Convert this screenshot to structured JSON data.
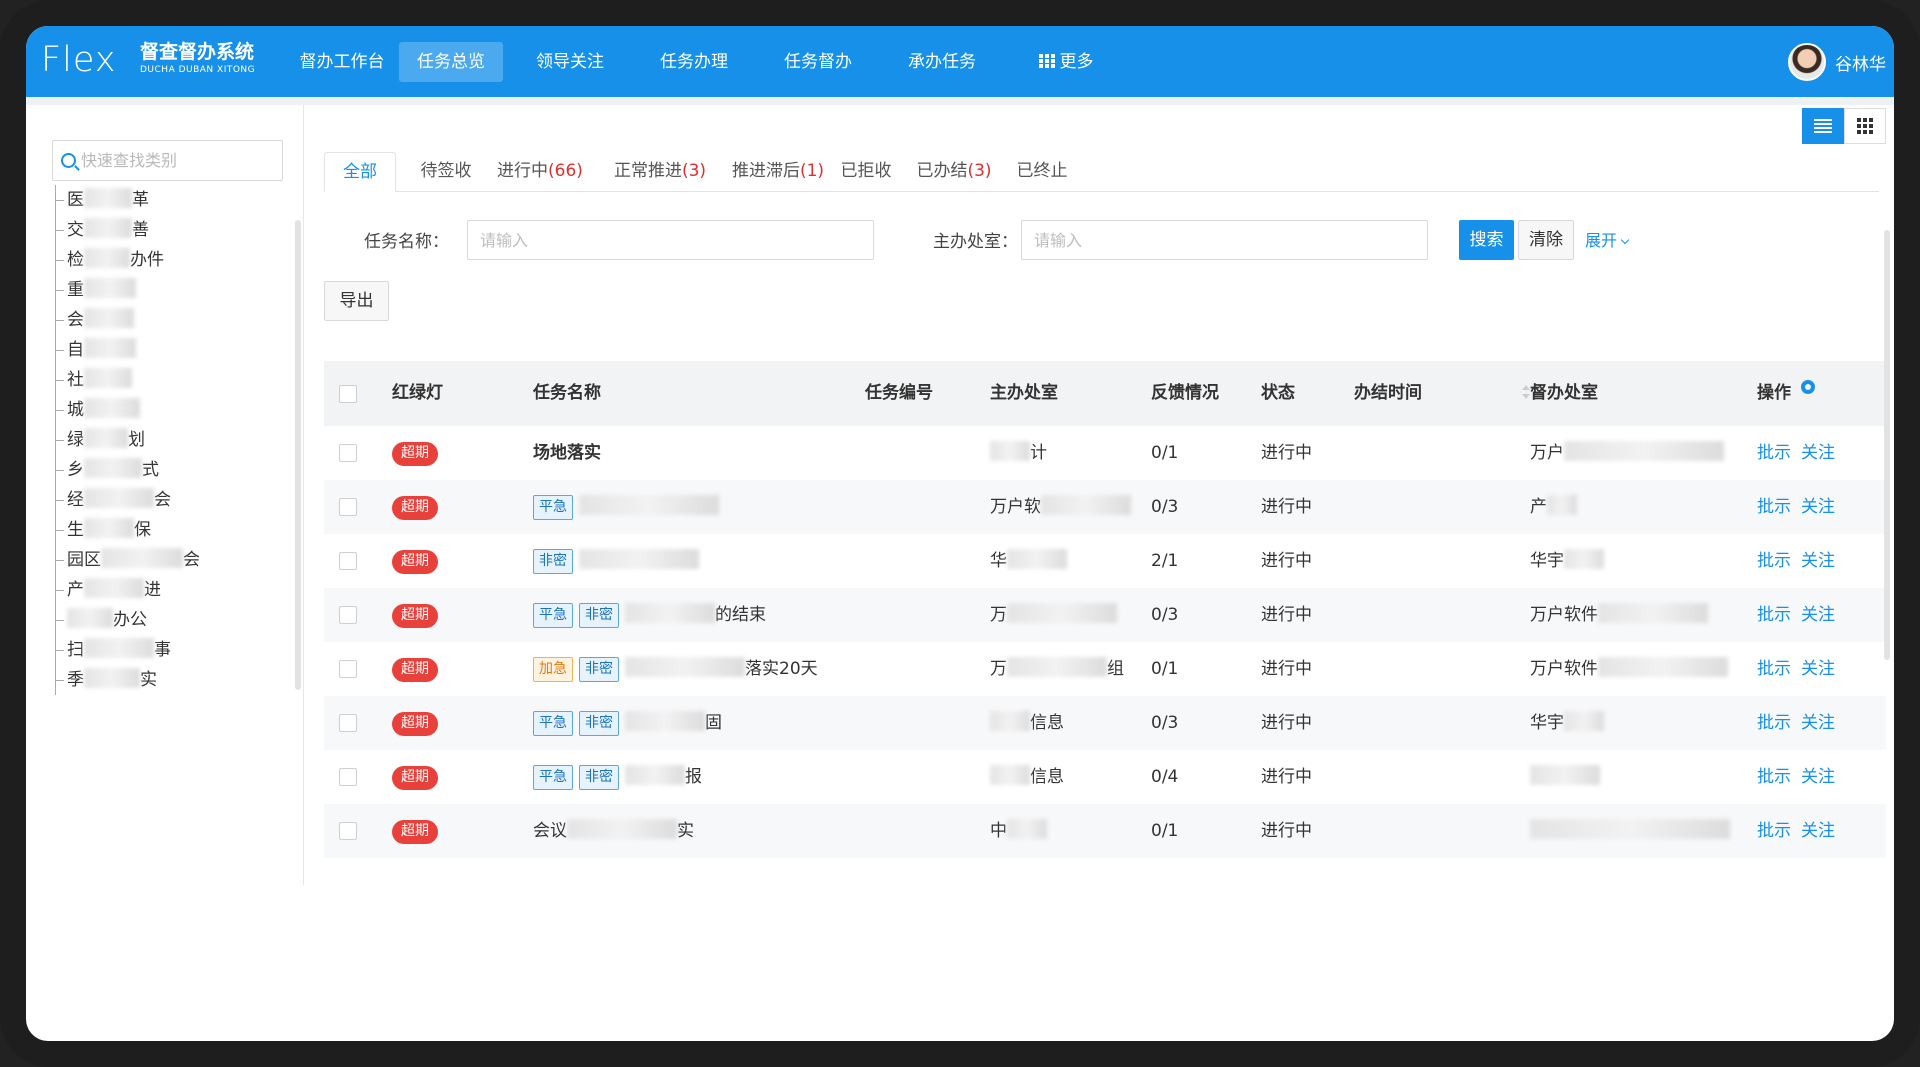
{
  "app": {
    "logo_text": "Flex",
    "name_cn": "督查督办系统",
    "name_en": "DUCHA DUBAN XITONG"
  },
  "nav": {
    "items": [
      "督办工作台",
      "任务总览",
      "领导关注",
      "任务办理",
      "任务督办",
      "承办任务"
    ],
    "more_label": "更多",
    "active_index": 1
  },
  "user": {
    "name": "谷林华"
  },
  "sidebar": {
    "search_placeholder": "快速查找类别",
    "items": [
      {
        "pre": "医",
        "post": "革"
      },
      {
        "pre": "交",
        "post": "善"
      },
      {
        "pre": "检",
        "post": "办件"
      },
      {
        "pre": "重",
        "post": ""
      },
      {
        "pre": "会",
        "post": ""
      },
      {
        "pre": "自",
        "post": ""
      },
      {
        "pre": "社",
        "post": ""
      },
      {
        "pre": "城",
        "post": ""
      },
      {
        "pre": "绿",
        "post": "划"
      },
      {
        "pre": "乡",
        "post": "式"
      },
      {
        "pre": "经",
        "post": "会"
      },
      {
        "pre": "生",
        "post": "保"
      },
      {
        "pre": "园区",
        "post": "会"
      },
      {
        "pre": "产",
        "post": "进"
      },
      {
        "pre": "",
        "post": "办公"
      },
      {
        "pre": "扫",
        "post": "事"
      },
      {
        "pre": "季",
        "post": "实"
      }
    ]
  },
  "tabs": [
    {
      "label": "全部",
      "count": ""
    },
    {
      "label": "待签收",
      "count": ""
    },
    {
      "label": "进行中",
      "count": "(66)"
    },
    {
      "label": "正常推进",
      "count": "(3)"
    },
    {
      "label": "推进滞后",
      "count": "(1)"
    },
    {
      "label": "已拒收",
      "count": ""
    },
    {
      "label": "已办结",
      "count": "(3)"
    },
    {
      "label": "已终止",
      "count": ""
    }
  ],
  "filters": {
    "task_name_label": "任务名称：",
    "task_name_placeholder": "请输入",
    "office_label": "主办处室：",
    "office_placeholder": "请输入",
    "search_label": "搜索",
    "clear_label": "清除",
    "expand_label": "展开",
    "export_label": "导出"
  },
  "table": {
    "headers": {
      "light": "红绿灯",
      "name": "任务名称",
      "code": "任务编号",
      "office": "主办处室",
      "feedback": "反馈情况",
      "status": "状态",
      "done_time": "办结时间",
      "supervise": "督办处室",
      "ops": "操作"
    },
    "op_labels": {
      "approve": "批示",
      "follow": "关注"
    },
    "rows": [
      {
        "badge": "超期",
        "tags": [],
        "name": "场地落实",
        "name_bold": true,
        "office": "",
        "office_tail": "计",
        "feedback": "0/1",
        "status": "进行中",
        "supervise": "万户"
      },
      {
        "badge": "超期",
        "tags": [
          "平急"
        ],
        "name": "",
        "name_bold": false,
        "office": "万户软",
        "office_tail": "",
        "feedback": "0/3",
        "status": "进行中",
        "supervise": "产"
      },
      {
        "badge": "超期",
        "tags": [
          "非密"
        ],
        "name": "",
        "name_bold": false,
        "office": "华",
        "office_tail": "",
        "feedback": "2/1",
        "status": "进行中",
        "supervise": "华宇"
      },
      {
        "badge": "超期",
        "tags": [
          "平急",
          "非密"
        ],
        "name": "的结束",
        "name_bold": false,
        "office": "万",
        "office_tail": "",
        "feedback": "0/3",
        "status": "进行中",
        "supervise": "万户软件"
      },
      {
        "badge": "超期",
        "tags": [
          "加急",
          "非密"
        ],
        "name": "落实20天",
        "name_bold": false,
        "office": "万",
        "office_tail": "组",
        "feedback": "0/1",
        "status": "进行中",
        "supervise": "万户软件"
      },
      {
        "badge": "超期",
        "tags": [
          "平急",
          "非密"
        ],
        "name": "固",
        "name_bold": false,
        "office": "",
        "office_tail": "信息",
        "feedback": "0/3",
        "status": "进行中",
        "supervise": "华宇"
      },
      {
        "badge": "超期",
        "tags": [
          "平急",
          "非密"
        ],
        "name": "报",
        "name_bold": false,
        "office": "",
        "office_tail": "信息",
        "feedback": "0/4",
        "status": "进行中",
        "supervise": ""
      },
      {
        "badge": "超期",
        "tags": [],
        "name": "会议",
        "name_tail": "实",
        "name_bold": false,
        "office": "中",
        "office_tail": "",
        "feedback": "0/1",
        "status": "进行中",
        "supervise": ""
      }
    ]
  },
  "colors": {
    "brand": "#1690e8",
    "danger": "#e8403a"
  }
}
